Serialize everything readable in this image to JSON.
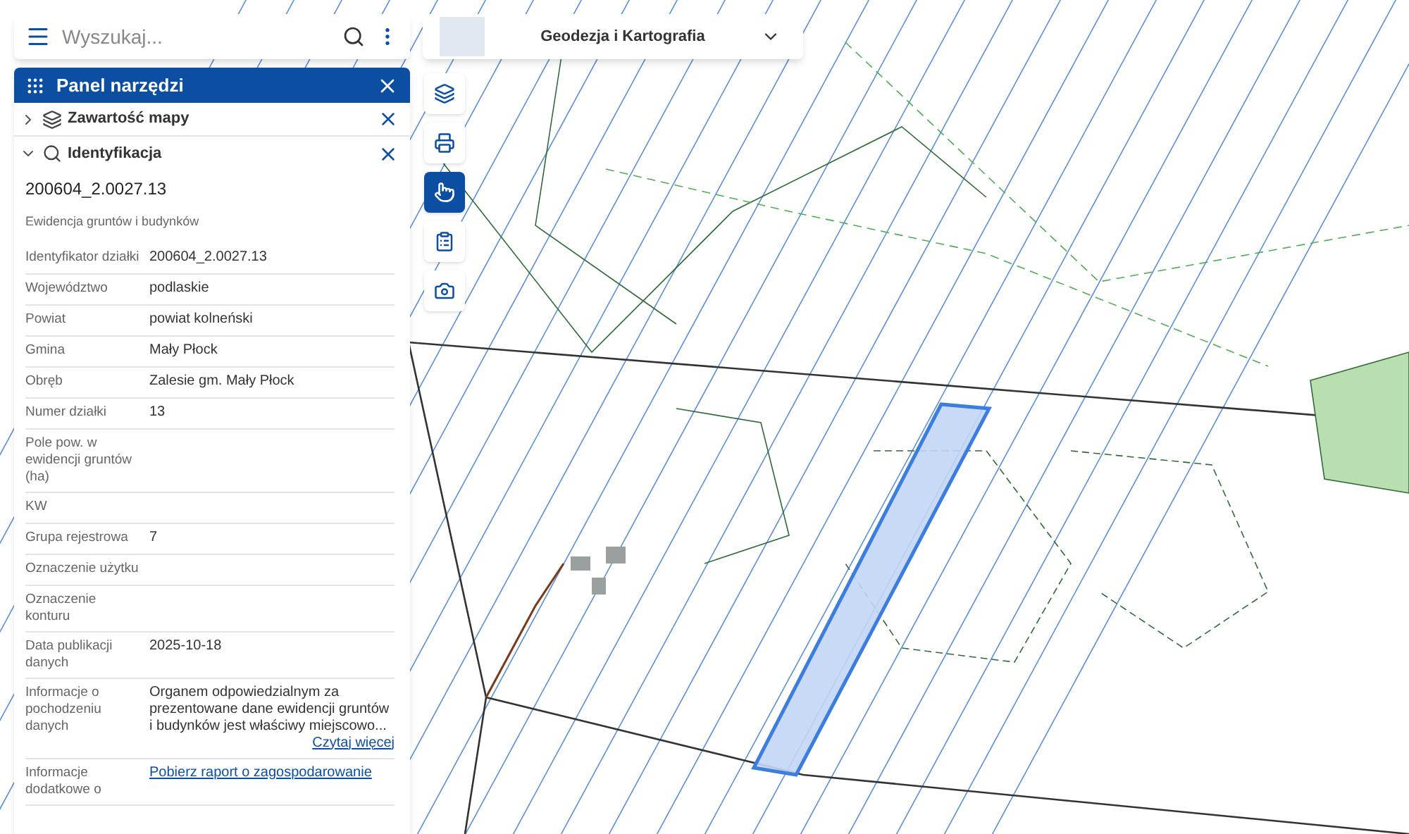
{
  "search": {
    "placeholder": "Wyszukaj..."
  },
  "panel": {
    "title": "Panel narzędzi",
    "sections": [
      {
        "kind": "layers",
        "title": "Zawartość mapy",
        "expanded": false
      },
      {
        "kind": "search",
        "title": "Identyfikacja",
        "expanded": true
      }
    ]
  },
  "identification": {
    "id": "200604_2.0027.13",
    "source": "Ewidencja gruntów i budynków",
    "rows": [
      {
        "label": "Identyfikator działki",
        "value": "200604_2.0027.13"
      },
      {
        "label": "Województwo",
        "value": "podlaskie"
      },
      {
        "label": "Powiat",
        "value": "powiat kolneński"
      },
      {
        "label": "Gmina",
        "value": "Mały Płock"
      },
      {
        "label": "Obręb",
        "value": "Zalesie gm. Mały Płock"
      },
      {
        "label": "Numer działki",
        "value": "13"
      },
      {
        "label": "Pole pow. w ewidencji gruntów (ha)"
      },
      {
        "label": "KW"
      },
      {
        "label": "Grupa rejestrowa",
        "value": "7"
      },
      {
        "label": "Oznaczenie użytku"
      },
      {
        "label": "Oznaczenie konturu"
      },
      {
        "label": "Data publikacji danych",
        "value": "2025-10-18"
      },
      {
        "label": "Informacje o pochodzeniu danych",
        "value": "Organem odpowiedzialnym za prezentowane dane ewidencji gruntów i budynków jest właściwy miejscowo...",
        "more": "Czytaj więcej"
      },
      {
        "label": "Informacje dodatkowe o",
        "link": "Pobierz raport o zagospodarowanie"
      }
    ]
  },
  "service": {
    "title": "Geodezja i Kartografia"
  },
  "tools": [
    {
      "kind": "layers",
      "selected": false
    },
    {
      "kind": "print",
      "selected": false
    },
    {
      "kind": "identify",
      "selected": true
    },
    {
      "kind": "clipboard",
      "selected": false
    },
    {
      "kind": "camera",
      "selected": false
    }
  ]
}
